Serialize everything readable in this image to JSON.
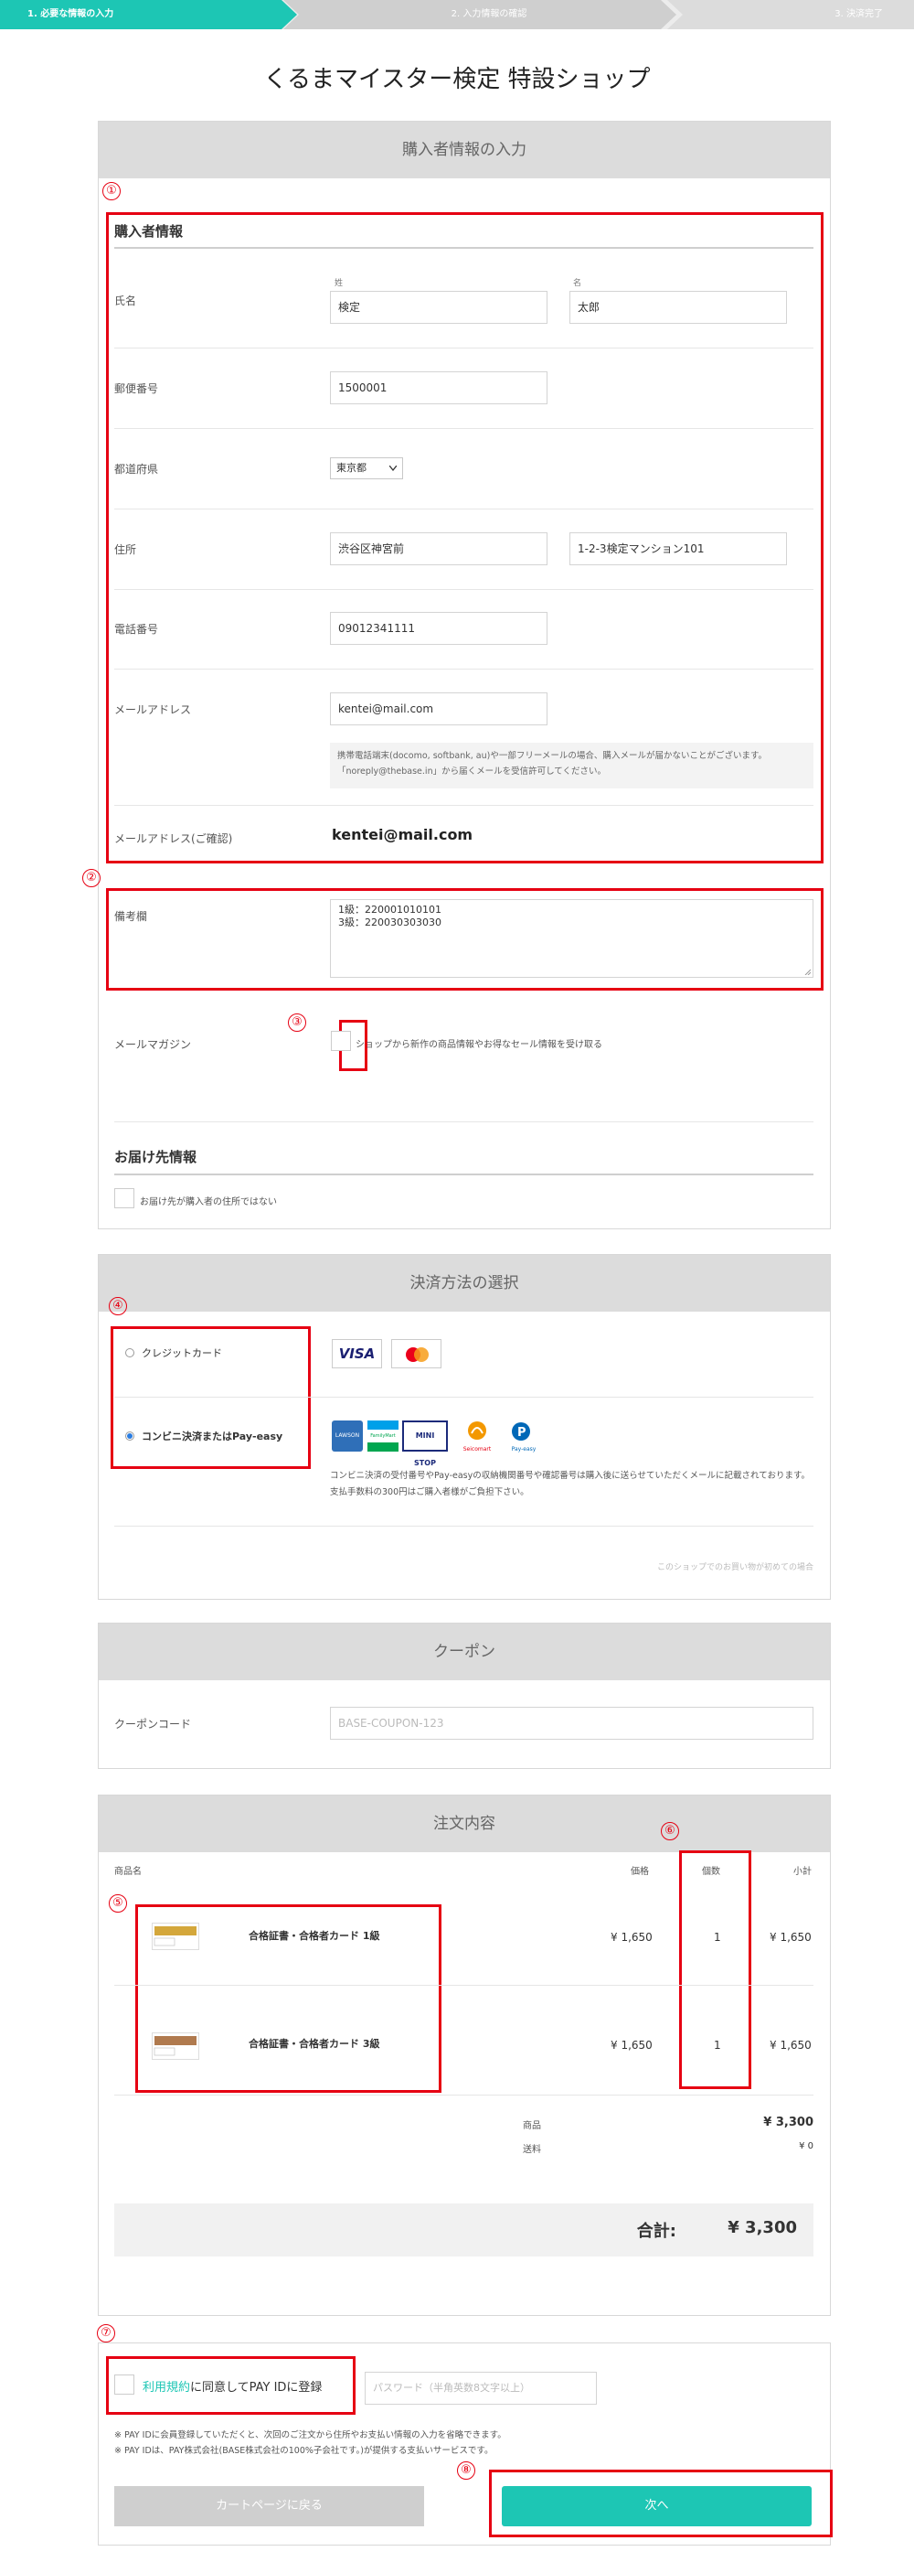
{
  "steps": [
    "1. 必要な情報の入力",
    "2. 入力情報の確認",
    "3. 決済完了"
  ],
  "shop_title": "くるまマイスター検定 特設ショップ",
  "buyer": {
    "header": "購入者情報の入力",
    "section": "購入者情報",
    "name_label": "氏名",
    "sei_sub": "姓",
    "mei_sub": "名",
    "sei_value": "検定",
    "mei_value": "太郎",
    "zip_label": "郵便番号",
    "zip_value": "1500001",
    "pref_label": "都道府県",
    "pref_value": "東京都",
    "addr_label": "住所",
    "addr1_value": "渋谷区神宮前",
    "addr2_value": "1-2-3検定マンション101",
    "tel_label": "電話番号",
    "tel_value": "09012341111",
    "mail_label": "メールアドレス",
    "mail_value": "kentei@mail.com",
    "mail_note": "携帯電話端末(docomo, softbank, au)や一部フリーメールの場合、購入メールが届かないことがございます。「noreply@thebase.in」から届くメールを受信許可してください。",
    "mail_confirm_label": "メールアドレス(ご確認)",
    "mail_confirm_value": "kentei@mail.com",
    "remarks_label": "備考欄",
    "remarks_line1": "1級：220001010101",
    "remarks_line2": "3級：220030303030",
    "magazine_label": "メールマガジン",
    "magazine_text": "ショップから新作の商品情報やお得なセール情報を受け取る",
    "delivery_section": "お届け先情報",
    "delivery_text": "お届け先が購入者の住所ではない"
  },
  "payment": {
    "header": "決済方法の選択",
    "credit_label": "クレジットカード",
    "conv_label": "コンビニ決済またはPay-easy",
    "visa": "VISA",
    "conv_logos": [
      "LAWSON",
      "FamilyMart",
      "MINI STOP",
      "Seicomart",
      "Pay-easy"
    ],
    "conv_note": "コンビニ決済の受付番号やPay-easyの収納機関番号や確認番号は購入後に送らせていただくメールに記載されております。支払手数料の300円はご購入者様がご負担下さい。",
    "first_time": "このショップでのお買い物が初めての場合"
  },
  "coupon": {
    "header": "クーポン",
    "label": "クーポンコード",
    "placeholder": "BASE-COUPON-123"
  },
  "order": {
    "header": "注文内容",
    "col_name": "商品名",
    "col_price": "価格",
    "col_qty": "個数",
    "col_subtotal": "小計",
    "items": [
      {
        "name": "合格証書・合格者カード 1級",
        "price": "¥ 1,650",
        "qty": "1",
        "subtotal": "¥ 1,650"
      },
      {
        "name": "合格証書・合格者カード 3級",
        "price": "¥ 1,650",
        "qty": "1",
        "subtotal": "¥ 1,650"
      }
    ],
    "goods_label": "商品",
    "goods_value": "¥ 3,300",
    "ship_label": "送料",
    "ship_value": "¥ 0",
    "total_label": "合計:",
    "total_value": "¥ 3,300"
  },
  "payid": {
    "terms_link": "利用規約",
    "terms_text": "に同意してPAY IDに登録",
    "pw_placeholder": "パスワード（半角英数8文字以上）",
    "note1": "※ PAY IDに会員登録していただくと、次回のご注文から住所やお支払い情報の入力を省略できます。",
    "note2": "※ PAY IDは、PAY株式会社(BASE株式会社の100%子会社です。)が提供する支払いサービスです。",
    "back_button": "カートページに戻る",
    "next_button": "次へ"
  },
  "markers": [
    "①",
    "②",
    "③",
    "④",
    "⑤",
    "⑥",
    "⑦",
    "⑧"
  ],
  "colors": {
    "accent": "#1dc6b4",
    "highlight": "#e60012",
    "header_bg": "#dcdcdc"
  }
}
